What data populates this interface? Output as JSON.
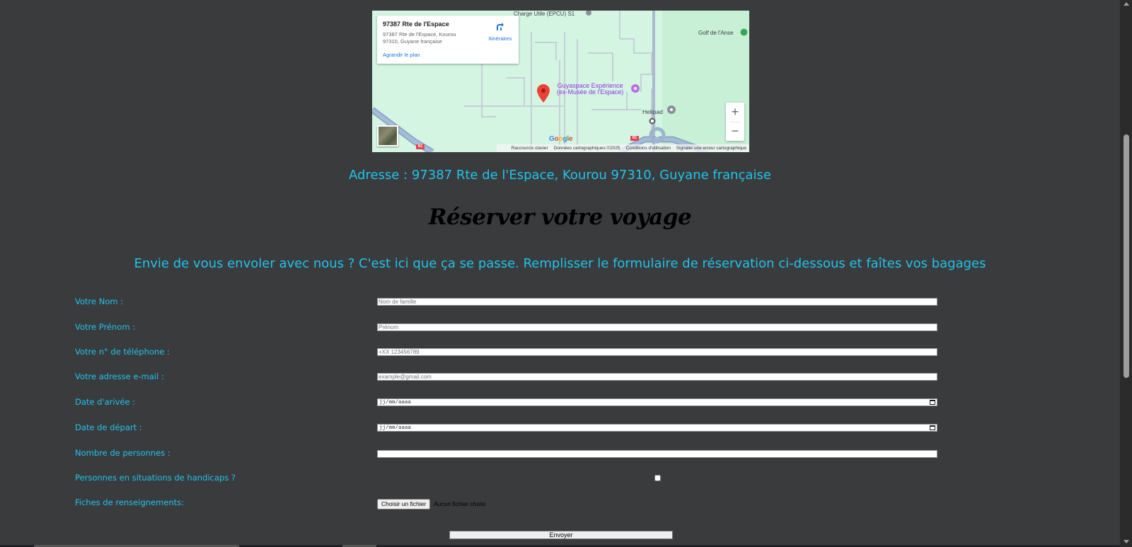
{
  "map": {
    "card": {
      "title": "97387 Rte de l'Espace",
      "address_line1": "97387 Rte de l'Espace, Kourou",
      "address_line2": "97310, Guyane française",
      "directions_label": "Itinéraires",
      "enlarge_link": "Agrandir le plan"
    },
    "labels": {
      "epcu": "Charge Utile (EPCU) S1",
      "golf": "Golf de l'Anse",
      "guyaspace_1": "Guyaspace Expérience",
      "guyaspace_2": "(ex-Musée de l'Espace)",
      "helipad": "Helipad",
      "road_n1": "N1"
    },
    "zoom_in": "+",
    "zoom_out": "−",
    "logo": "Google",
    "footer": {
      "shortcuts": "Raccourcis clavier",
      "data": "Données cartographiques ©2025",
      "terms": "Conditions d'utilisation",
      "report": "Signaler une erreur cartographique"
    }
  },
  "address": "Adresse : 97387 Rte de l'Espace, Kourou 97310, Guyane française",
  "title": "Réserver votre voyage",
  "subtitle": "Envie de vous envoler avec nous ? C'est ici que ça se passe. Remplisser le formulaire de réservation ci-dessous et faîtes vos bagages",
  "form": {
    "nom": {
      "label": "Votre Nom :",
      "placeholder": "Nom de famille"
    },
    "prenom": {
      "label": "Votre Prénom :",
      "placeholder": "Prénom"
    },
    "telephone": {
      "label": "Votre n° de téléphone :",
      "placeholder": "+XX 123456789"
    },
    "email": {
      "label": "Votre adresse e-mail :",
      "placeholder": "example@gmail.com"
    },
    "arrivee": {
      "label": "Date d'arivée :",
      "placeholder": "jj/mm/aaaa"
    },
    "depart": {
      "label": "Date de départ :",
      "placeholder": "jj/mm/aaaa"
    },
    "personnes": {
      "label": "Nombre de personnes :",
      "value": ""
    },
    "handicap": {
      "label": "Personnes en situations de handicaps ?",
      "checked": false
    },
    "fiches": {
      "label": "Fiches de renseignements:",
      "button": "Choisir un fichier",
      "status": "Aucun fichier choisi"
    },
    "submit": "Envoyer"
  },
  "colors": {
    "background": "#3a3b3d",
    "accent_text": "#1fc4ec",
    "title": "#000000",
    "map_green": "#d4f5e2",
    "marker_red": "#ea4335",
    "poi_purple": "#9334e6"
  },
  "icons": [
    "directions-icon",
    "map-pin-icon",
    "poi-icon",
    "satellite-thumbnail",
    "calendar-icon"
  ]
}
